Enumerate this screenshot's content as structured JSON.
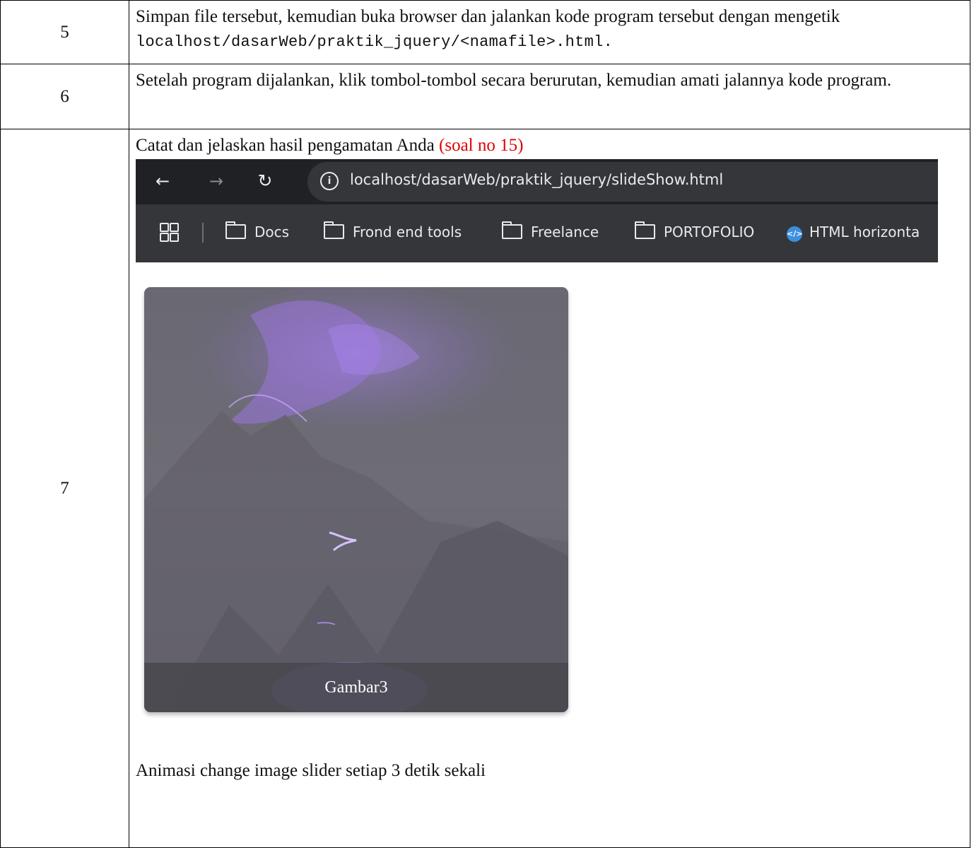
{
  "rows": [
    {
      "number": "5",
      "text": "Simpan file tersebut, kemudian buka browser dan jalankan kode program tersebut dengan mengetik",
      "code": "localhost/dasarWeb/praktik_jquery/<namafile>.html."
    },
    {
      "number": "6",
      "text": "Setelah program dijalankan, klik tombol-tombol secara berurutan, kemudian amati jalannya kode program."
    },
    {
      "number": "7",
      "instruction": "Catat dan jelaskan hasil pengamatan Anda",
      "note": "(soal no 15)",
      "description": "Animasi change image slider setiap 3 detik sekali"
    }
  ],
  "browser": {
    "url": "localhost/dasarWeb/praktik_jquery/slideShow.html",
    "bookmarks": [
      "Docs",
      "Frond end tools",
      "Freelance",
      "PORTOFOLIO",
      "HTML horizonta"
    ]
  },
  "slide": {
    "caption": "Gambar3"
  },
  "colors": {
    "note": "#e00000",
    "chrome_dark": "#202124",
    "chrome_bar": "#35363a"
  }
}
